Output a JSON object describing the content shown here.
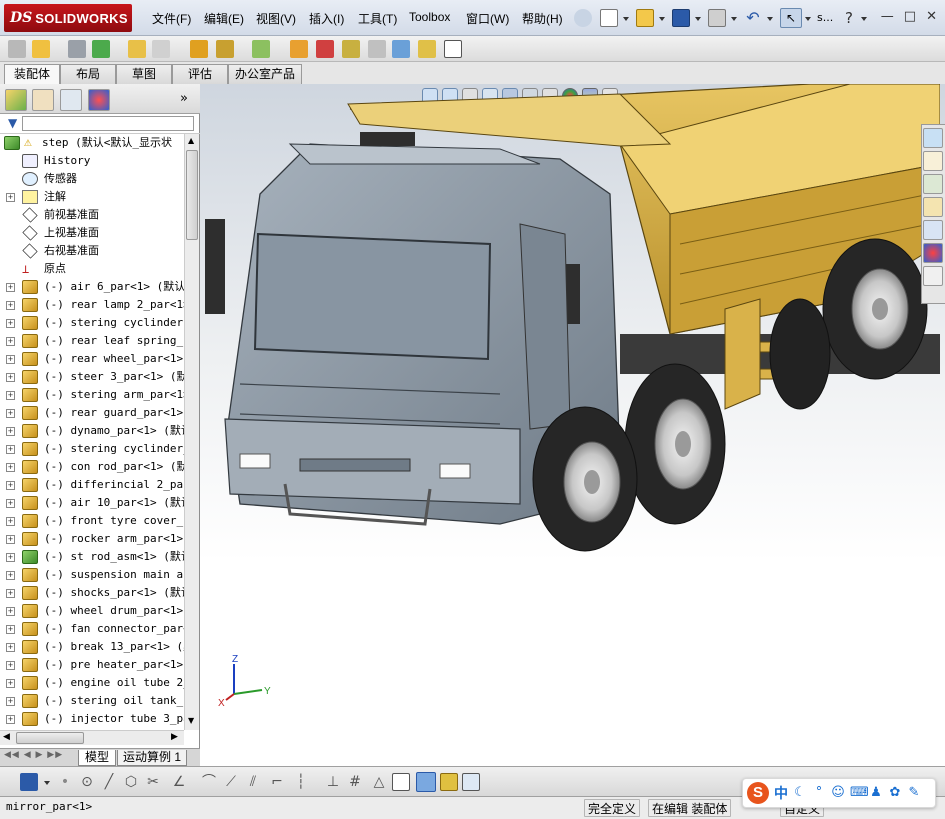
{
  "app": {
    "brand_ds": "DS",
    "brand_name": "SOLIDWORKS"
  },
  "menu": {
    "items": [
      {
        "label": "文件(F)"
      },
      {
        "label": "编辑(E)"
      },
      {
        "label": "视图(V)"
      },
      {
        "label": "插入(I)"
      },
      {
        "label": "工具(T)"
      },
      {
        "label": "Toolbox"
      },
      {
        "label": "窗口(W)"
      },
      {
        "label": "帮助(H)"
      }
    ],
    "search_label": "s..."
  },
  "command_tabs": [
    {
      "label": "装配体"
    },
    {
      "label": "布局"
    },
    {
      "label": "草图"
    },
    {
      "label": "评估"
    },
    {
      "label": "办公室产品"
    }
  ],
  "tree": {
    "root": "step  (默认<默认_显示状",
    "items": [
      {
        "label": "History"
      },
      {
        "label": "传感器"
      },
      {
        "label": "注解"
      },
      {
        "label": "前视基准面"
      },
      {
        "label": "上视基准面"
      },
      {
        "label": "右视基准面"
      },
      {
        "label": "原点"
      },
      {
        "label": "(-) air 6_par<1> (默认<"
      },
      {
        "label": "(-) rear lamp 2_par<1>"
      },
      {
        "label": "(-) stering cyclinder r"
      },
      {
        "label": "(-) rear leaf spring_pa"
      },
      {
        "label": "(-) rear wheel_par<1> ("
      },
      {
        "label": "(-) steer 3_par<1> (默认"
      },
      {
        "label": "(-) stering arm_par<1>"
      },
      {
        "label": "(-) rear guard_par<1> ("
      },
      {
        "label": "(-) dynamo_par<1> (默认"
      },
      {
        "label": "(-) stering cyclinder_p"
      },
      {
        "label": "(-) con rod_par<1> (默认"
      },
      {
        "label": "(-) differincial 2_par<"
      },
      {
        "label": "(-) air 10_par<1> (默认"
      },
      {
        "label": "(-) front tyre cover_pa"
      },
      {
        "label": "(-) rocker arm_par<1> ("
      },
      {
        "label": "(-) st rod_asm<1> (默认"
      },
      {
        "label": "(-) suspension main arm"
      },
      {
        "label": "(-) shocks_par<1> (默认"
      },
      {
        "label": "(-) wheel drum_par<1> ("
      },
      {
        "label": "(-) fan connector_par<1"
      },
      {
        "label": "(-) break 13_par<1> (默"
      },
      {
        "label": "(-) pre heater_par<1> ("
      },
      {
        "label": "(-) engine oil tube 2_p"
      },
      {
        "label": "(-) stering oil tank_pa"
      },
      {
        "label": "(-) injector tube 3_par"
      }
    ]
  },
  "bottom_tabs": [
    {
      "label": "模型"
    },
    {
      "label": "运动算例 1"
    }
  ],
  "triad": {
    "x": "X",
    "y": "Y",
    "z": "Z"
  },
  "status": {
    "selection": "mirror_par<1>",
    "definition": "完全定义",
    "mode": "在编辑 装配体",
    "custom": "自定义"
  },
  "ime": {
    "logo": "S",
    "lang": "中"
  },
  "colors": {
    "truck_body": "#d9b24a",
    "cab": "#8e9aa6",
    "tire": "#2a2a2a",
    "accent": "#1a6fd1"
  }
}
